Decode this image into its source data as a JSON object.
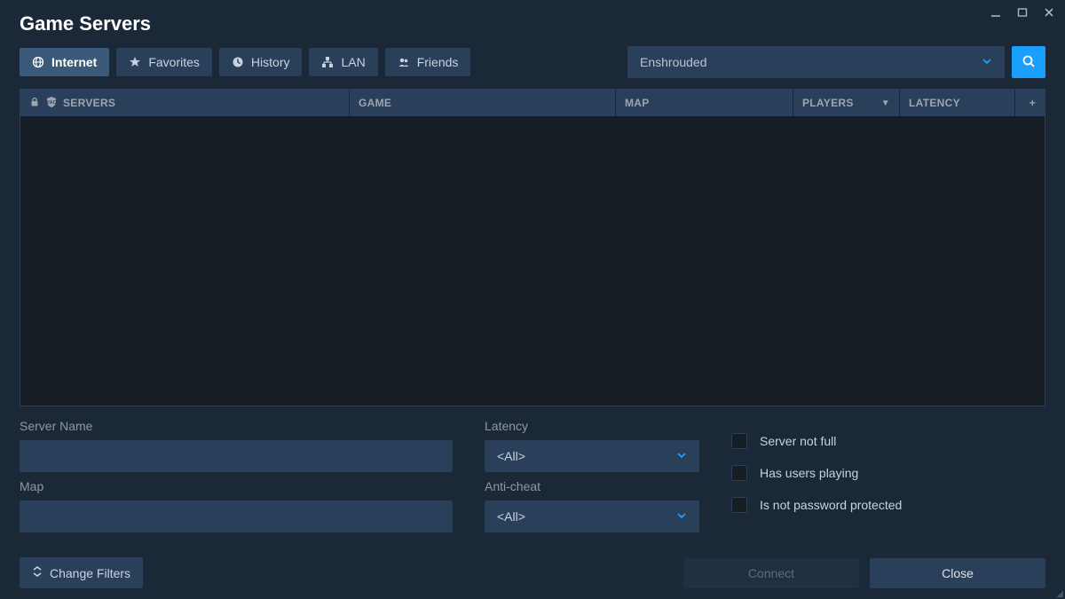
{
  "window": {
    "title": "Game Servers"
  },
  "tabs": {
    "internet": "Internet",
    "favorites": "Favorites",
    "history": "History",
    "lan": "LAN",
    "friends": "Friends"
  },
  "game_filter": {
    "selected": "Enshrouded"
  },
  "columns": {
    "servers": "SERVERS",
    "game": "GAME",
    "map": "MAP",
    "players": "PLAYERS",
    "latency": "LATENCY",
    "add": "+"
  },
  "filters": {
    "server_name_label": "Server Name",
    "server_name_value": "",
    "map_label": "Map",
    "map_value": "",
    "latency_label": "Latency",
    "latency_value": "<All>",
    "anticheat_label": "Anti-cheat",
    "anticheat_value": "<All>",
    "check_notfull": "Server not full",
    "check_hasusers": "Has users playing",
    "check_nopassword": "Is not password protected"
  },
  "buttons": {
    "change_filters": "Change Filters",
    "connect": "Connect",
    "close": "Close"
  }
}
